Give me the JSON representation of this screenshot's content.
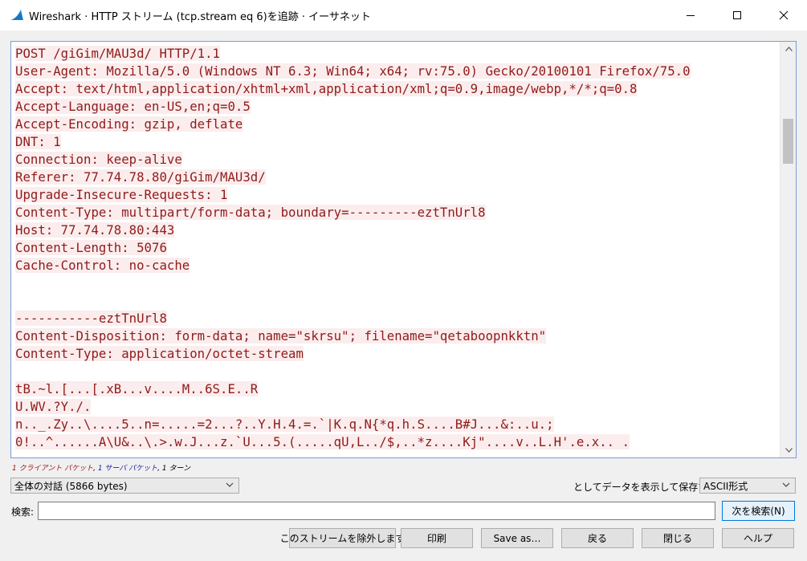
{
  "window": {
    "title": "Wireshark · HTTP ストリーム (tcp.stream eq 6)を追跡 · イーサネット"
  },
  "stream_lines": [
    "POST /giGim/MAU3d/ HTTP/1.1",
    "User-Agent: Mozilla/5.0 (Windows NT 6.3; Win64; x64; rv:75.0) Gecko/20100101 Firefox/75.0",
    "Accept: text/html,application/xhtml+xml,application/xml;q=0.9,image/webp,*/*;q=0.8",
    "Accept-Language: en-US,en;q=0.5",
    "Accept-Encoding: gzip, deflate",
    "DNT: 1",
    "Connection: keep-alive",
    "Referer: 77.74.78.80/giGim/MAU3d/",
    "Upgrade-Insecure-Requests: 1",
    "Content-Type: multipart/form-data; boundary=---------eztTnUrl8",
    "Host: 77.74.78.80:443",
    "Content-Length: 5076",
    "Cache-Control: no-cache",
    "",
    "",
    "-----------eztTnUrl8",
    "Content-Disposition: form-data; name=\"skrsu\"; filename=\"qetaboopnkktn\"",
    "Content-Type: application/octet-stream",
    "",
    "tB.~l.[...[.xB...v....M..6S.E..R",
    "U.WV.?Y./.",
    "n.._.Zy..\\....5..n=.....=2...?..Y.H.4.=.`|K.q.N{*q.h.S....B#J...&:..u.;",
    "0!..^......A\\U&..\\.>.w.J...z.`U...5.(.....qU,L../$,..*z....Kj\"....v..L.H'.e.x.. ."
  ],
  "stats": {
    "client": "1 クライアント パケット",
    "sep1": ", ",
    "server": "1 サーバ パケット",
    "sep2": ", ",
    "turns": "1 ターン"
  },
  "conversation_select": "全体の対話 (5866 bytes)",
  "save_label": "としてデータを表示して保存する",
  "format_select": "ASCII形式",
  "search": {
    "label": "検索:",
    "value": ""
  },
  "buttons": {
    "find_next": "次を検索(N)",
    "filter_out": "このストリームを除外します",
    "print": "印刷",
    "save_as": "Save as…",
    "back": "戻る",
    "close": "閉じる",
    "help": "ヘルプ"
  }
}
